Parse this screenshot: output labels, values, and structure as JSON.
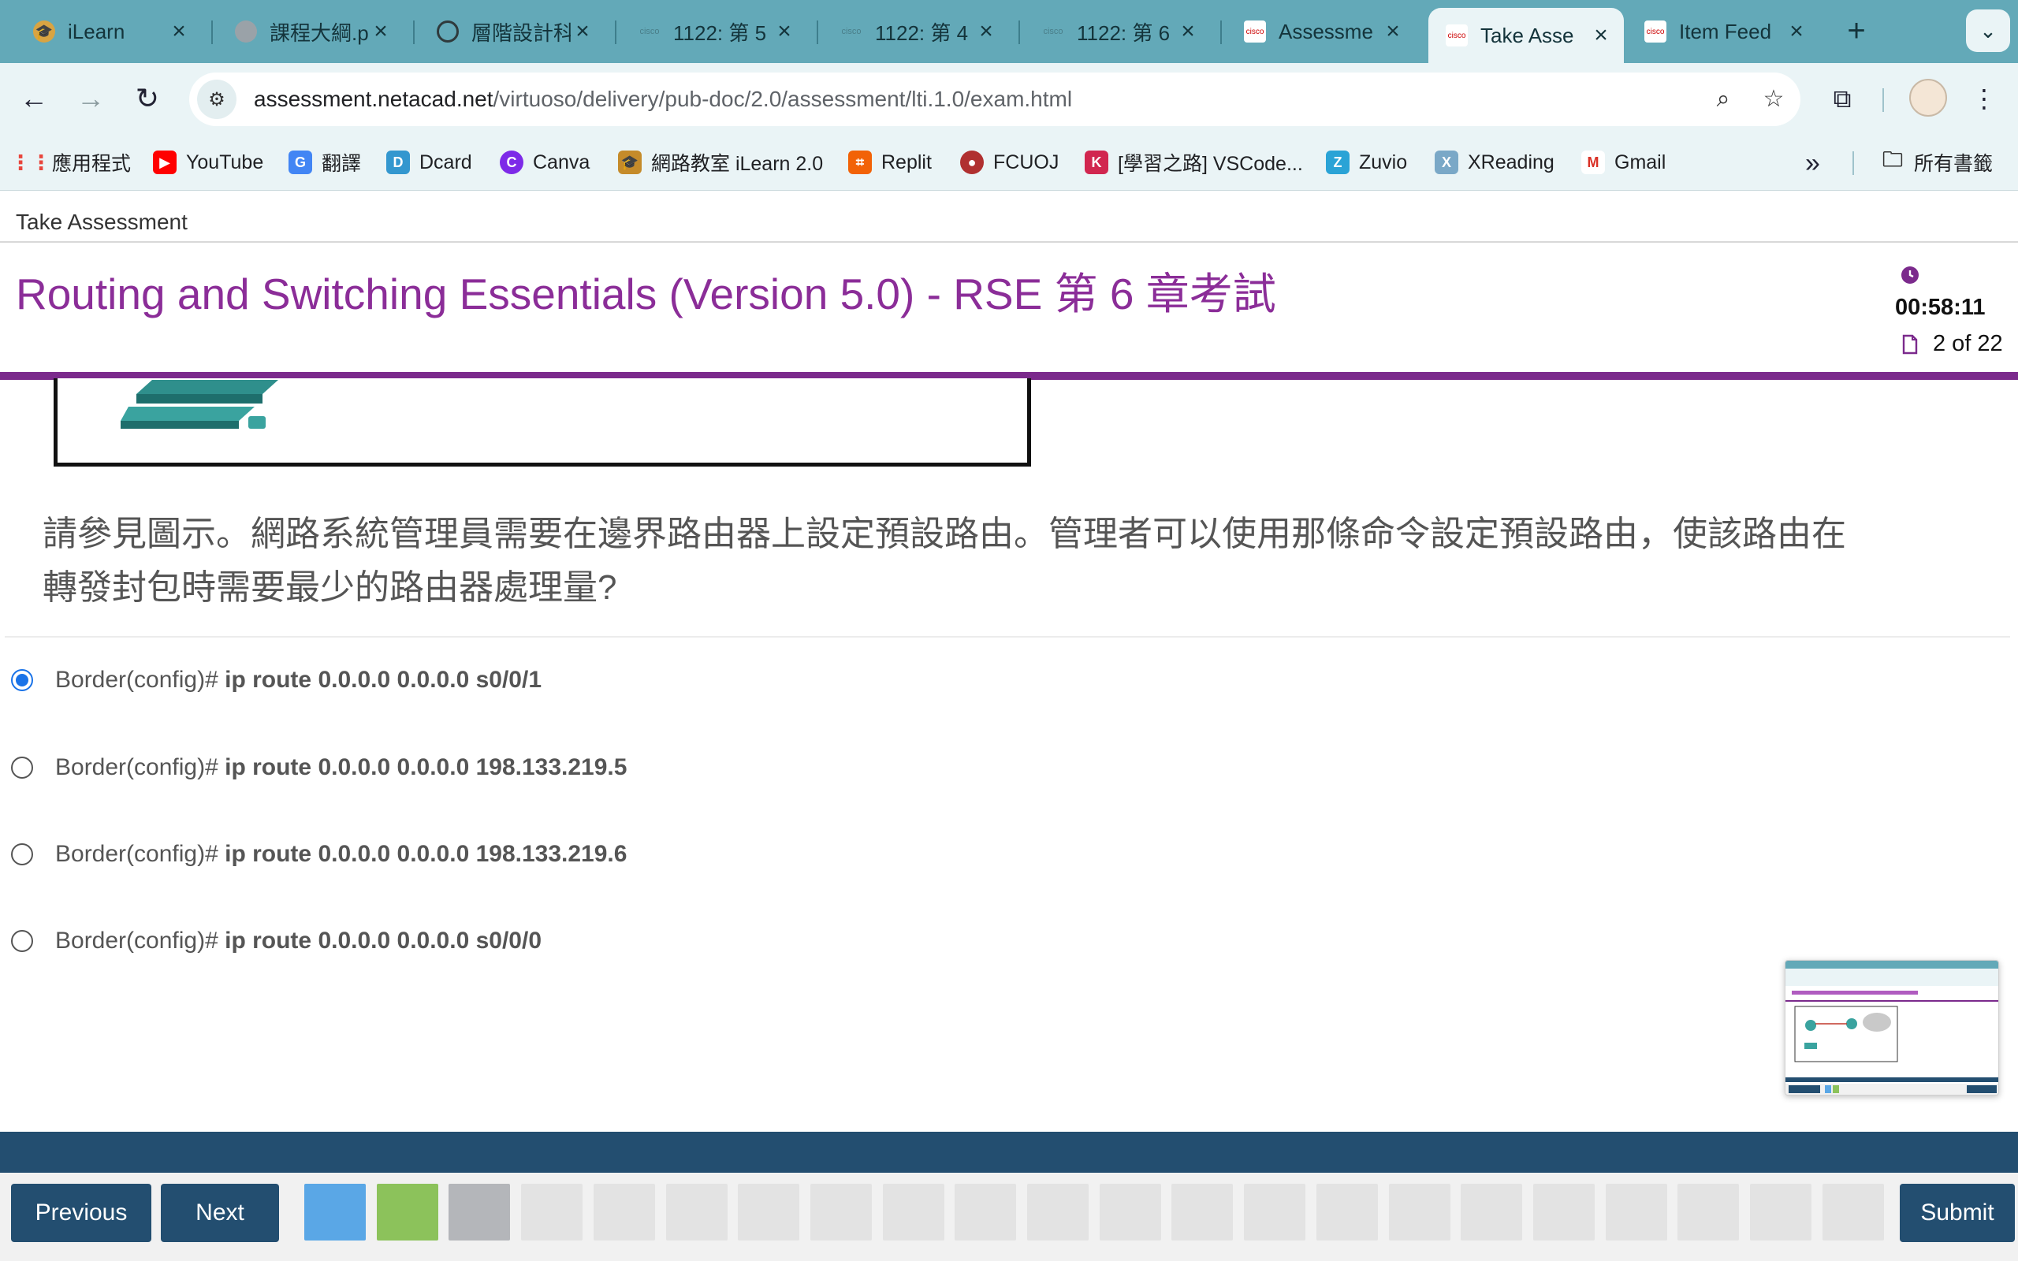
{
  "browser": {
    "tabs": [
      {
        "title": "iLearn",
        "icon": "ilearn-favicon",
        "active": false
      },
      {
        "title": "課程大綱.p",
        "icon": "course-favicon",
        "active": false
      },
      {
        "title": "層階設計科",
        "icon": "openai-favicon",
        "active": false
      },
      {
        "title": "1122: 第 5",
        "icon": "cisco-favicon",
        "active": false
      },
      {
        "title": "1122: 第 4",
        "icon": "cisco-favicon",
        "active": false
      },
      {
        "title": "1122: 第 6",
        "icon": "cisco-favicon",
        "active": false
      },
      {
        "title": "Assessme",
        "icon": "cisco-favicon",
        "active": false
      },
      {
        "title": "Take Asse",
        "icon": "cisco-favicon",
        "active": true
      },
      {
        "title": "Item Feed",
        "icon": "cisco-favicon",
        "active": false
      }
    ],
    "url_host": "assessment.netacad.net",
    "url_path": "/virtuoso/delivery/pub-doc/2.0/assessment/lti.1.0/exam.html",
    "bookmarks": [
      {
        "label": "應用程式",
        "icon": "apps-grid-icon",
        "color": "#e8453c"
      },
      {
        "label": "YouTube",
        "icon": "youtube-icon",
        "color": "#ff0000"
      },
      {
        "label": "翻譯",
        "icon": "google-translate-icon",
        "color": "#4285f4"
      },
      {
        "label": "Dcard",
        "icon": "dcard-icon",
        "color": "#3397cf"
      },
      {
        "label": "Canva",
        "icon": "canva-icon",
        "color": "#7d2ae8"
      },
      {
        "label": "網路教室 iLearn 2.0",
        "icon": "ilearn-icon",
        "color": "#c58b2a"
      },
      {
        "label": "Replit",
        "icon": "replit-icon",
        "color": "#f26207"
      },
      {
        "label": "FCUOJ",
        "icon": "fcuoj-icon",
        "color": "#b03030"
      },
      {
        "label": "[學習之路] VSCode...",
        "icon": "bookmark-k-icon",
        "color": "#d1264f"
      },
      {
        "label": "Zuvio",
        "icon": "zuvio-icon",
        "color": "#2aa3d6"
      },
      {
        "label": "XReading",
        "icon": "xreading-icon",
        "color": "#7aa8c7"
      },
      {
        "label": "Gmail",
        "icon": "gmail-icon",
        "color": "#d93025"
      }
    ],
    "all_bookmarks_label": "所有書籤"
  },
  "page": {
    "breadcrumb": "Take Assessment",
    "title": "Routing and Switching Essentials (Version 5.0) - RSE 第 6 章考試",
    "timer": "00:58:11",
    "progress": "2 of 22",
    "accent_color": "#7b2a8c"
  },
  "question": {
    "text": "請參見圖示。網路系統管理員需要在邊界路由器上設定預設路由。管理者可以使用那條命令設定預設路由，使該路由在轉發封包時需要最少的路由器處理量?",
    "options": [
      {
        "prompt": "Border(config)# ",
        "command": "ip route 0.0.0.0 0.0.0.0 s0/0/1",
        "selected": true
      },
      {
        "prompt": "Border(config)# ",
        "command": "ip route 0.0.0.0 0.0.0.0 198.133.219.5",
        "selected": false
      },
      {
        "prompt": "Border(config)# ",
        "command": "ip route 0.0.0.0 0.0.0.0 198.133.219.6",
        "selected": false
      },
      {
        "prompt": "Border(config)# ",
        "command": "ip route 0.0.0.0 0.0.0.0 s0/0/0",
        "selected": false
      }
    ]
  },
  "footer": {
    "previous_label": "Previous",
    "next_label": "Next",
    "submit_label": "Submit",
    "question_states": [
      "visited",
      "current",
      "flagged",
      "unanswered",
      "unanswered",
      "unanswered",
      "unanswered",
      "unanswered",
      "unanswered",
      "unanswered",
      "unanswered",
      "unanswered",
      "unanswered",
      "unanswered",
      "unanswered",
      "unanswered",
      "unanswered",
      "unanswered",
      "unanswered",
      "unanswered",
      "unanswered",
      "unanswered"
    ],
    "state_colors": {
      "visited": "#5aa7e6",
      "current": "#8cc25b",
      "flagged": "#b4b6ba",
      "unanswered": "#e3e3e3"
    }
  }
}
